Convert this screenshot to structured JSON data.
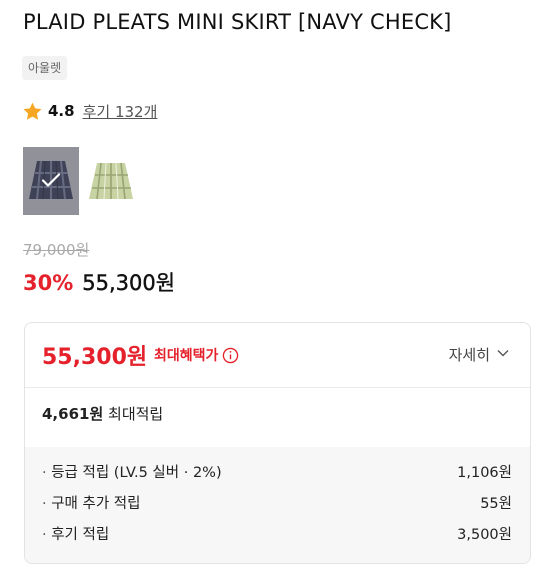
{
  "product": {
    "title": "PLAID PLEATS MINI SKIRT [NAVY CHECK]",
    "tag": "아울렛",
    "rating": "4.8",
    "reviews_label": "후기 132개"
  },
  "thumbnails": [
    {
      "name": "navy check",
      "selected": true
    },
    {
      "name": "green check",
      "selected": false
    }
  ],
  "pricing": {
    "original_price": "79,000원",
    "discount": "30%",
    "sale_price": "55,300원"
  },
  "benefit": {
    "price": "55,300원",
    "label": "최대혜택가",
    "toggle_label": "자세히",
    "accrual_amount": "4,661원",
    "accrual_label": "최대적립",
    "breakdown": [
      {
        "label": "등급 적립 (LV.5 실버 · 2%)",
        "value": "1,106원"
      },
      {
        "label": "구매 추가 적립",
        "value": "55원"
      },
      {
        "label": "후기 적립",
        "value": "3,500원"
      }
    ]
  },
  "colors": {
    "accent": "#e5222c",
    "star": "#f5a623",
    "text": "#111111",
    "muted": "#aaaaaa"
  },
  "icons": [
    "star-icon",
    "check-icon",
    "info-icon",
    "chevron-down-icon"
  ]
}
